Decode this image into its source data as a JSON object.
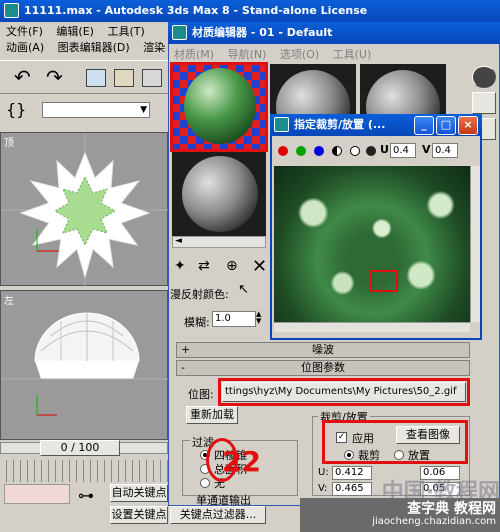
{
  "main_window": {
    "title": "11111.max - Autodesk 3ds Max 8 - Stand-alone License",
    "menu": [
      "文件(F)",
      "编辑(E)",
      "工具(T)",
      "动画(A)",
      "图表编辑器(D)",
      "渲染"
    ],
    "viewport_top_label": "顶",
    "viewport_left_label": "左",
    "timeline": "0 / 100",
    "auto_key": "自动关键点",
    "set_key": "设置关键点",
    "key_filters": "关键点过滤器..."
  },
  "material_editor": {
    "title": "材质编辑器 - 01 - Default",
    "menu": [
      "材质(M)",
      "导航(N)",
      "选项(O)",
      "工具(U)"
    ],
    "diffuse_label": "漫反射颜色:",
    "blur_label": "模糊:",
    "blur_value": "1.0",
    "rollout_noise": "噪波",
    "rollout_bitmap_params": "位图参数",
    "bitmap_label": "位图:",
    "bitmap_path": "ttings\\hyz\\My Documents\\My Pictures\\50_2.gif",
    "reload_button": "重新加载",
    "filter_label": "过滤",
    "filter_options": [
      "四棱锥",
      "总面积",
      "无"
    ],
    "crop_place_label": "裁剪/放置",
    "apply_label": "应用",
    "view_image_button": "查看图像",
    "crop_option": "裁剪",
    "place_option": "放置",
    "u_label": "U:",
    "u_value": "0.412",
    "v_label": "V:",
    "v_value": "0.465",
    "w_value": "0.06",
    "h_value": "0.05",
    "mono_output_label": "单通道输出",
    "annotation": "22"
  },
  "crop_window": {
    "title": "指定裁剪/放置 (...",
    "u_label": "U",
    "u_value": "0.4",
    "v_label": "V",
    "v_value": "0.4"
  },
  "watermark": {
    "site": "查字典 教程网",
    "url": "jiaocheng.chazidian.com"
  },
  "colors": {
    "titlebar": "#0a5fd8",
    "highlight": "#e01010",
    "annotation": "#e01010"
  }
}
